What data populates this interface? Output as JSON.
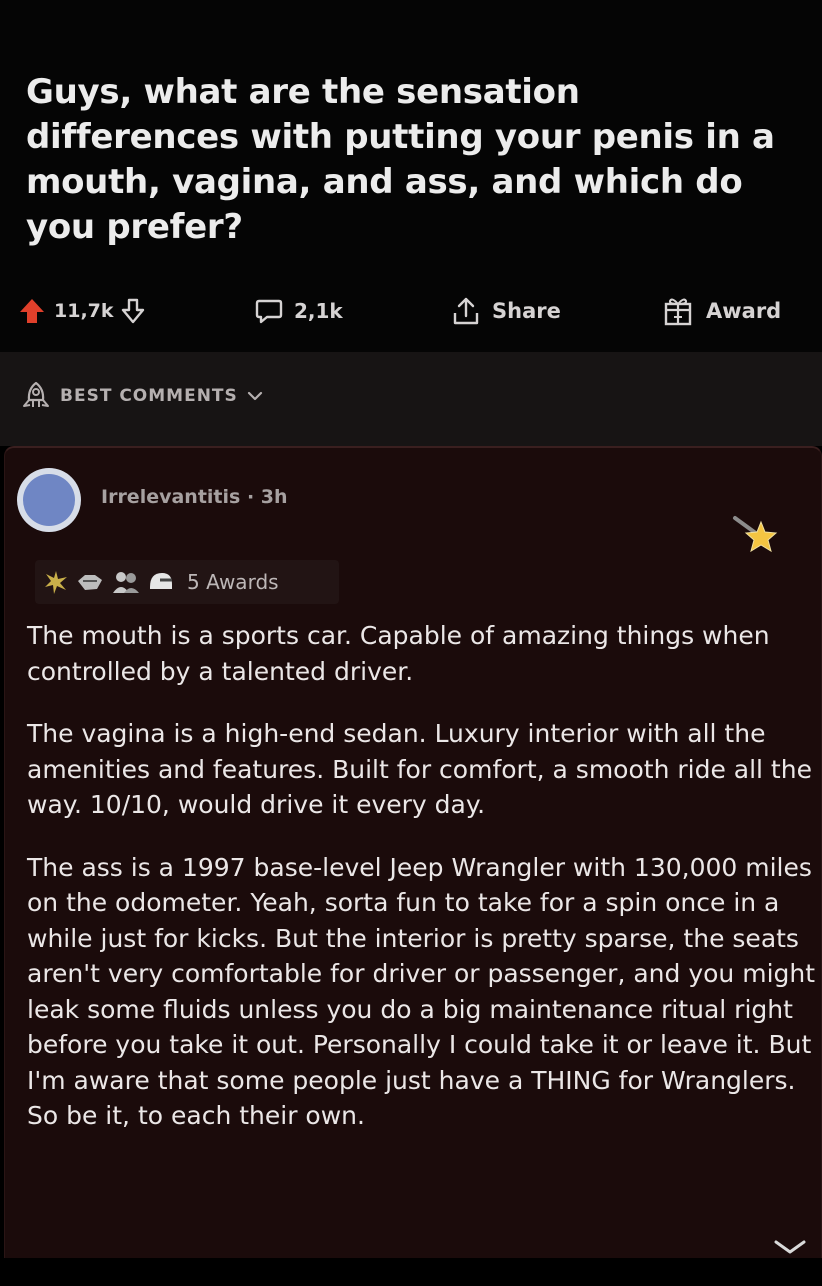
{
  "post": {
    "title": "Guys, what are the sensation differences with putting your penis in a mouth, vagina, and ass, and which do you prefer?"
  },
  "actions": {
    "upvote_count": "11,7k",
    "comment_count": "2,1k",
    "share_label": "Share",
    "award_label": "Award"
  },
  "sort": {
    "label": "BEST COMMENTS"
  },
  "comment": {
    "author": "Irrelevantitis",
    "separator": "·",
    "time": "3h",
    "awards_label": "5 Awards",
    "paragraphs": [
      "The mouth is a sports car. Capable of amazing things when controlled by a talented driver.",
      "The vagina is a high-end sedan. Luxury interior with all the amenities and features. Built for comfort, a smooth ride all the way.  10/10, would drive it every day.",
      "The ass is a 1997 base-level Jeep Wrangler with 130,000 miles on the odometer. Yeah, sorta fun to take for a spin once in a while just for kicks. But the interior is pretty sparse, the seats aren't very comfortable for driver or passenger, and you might leak some fluids unless you do a big maintenance ritual right before you take it out. Personally I could take it or leave it. But I'm aware that some people just have a THING for Wranglers. So be it, to each their own."
    ]
  },
  "colors": {
    "background": "#000000",
    "sort_bar": "#171414",
    "comment_card": "#1b0b0b",
    "upvote_active": "#e0402b",
    "text": "#ebe7e7"
  },
  "icons": {
    "upvote": "arrow-up-icon",
    "downvote": "arrow-down-icon",
    "comments": "comment-bubble-icon",
    "share": "share-icon",
    "award": "gift-icon",
    "sort": "rocket-icon",
    "sort_chevron": "chevron-down-icon",
    "award_star": "star-award-icon"
  }
}
